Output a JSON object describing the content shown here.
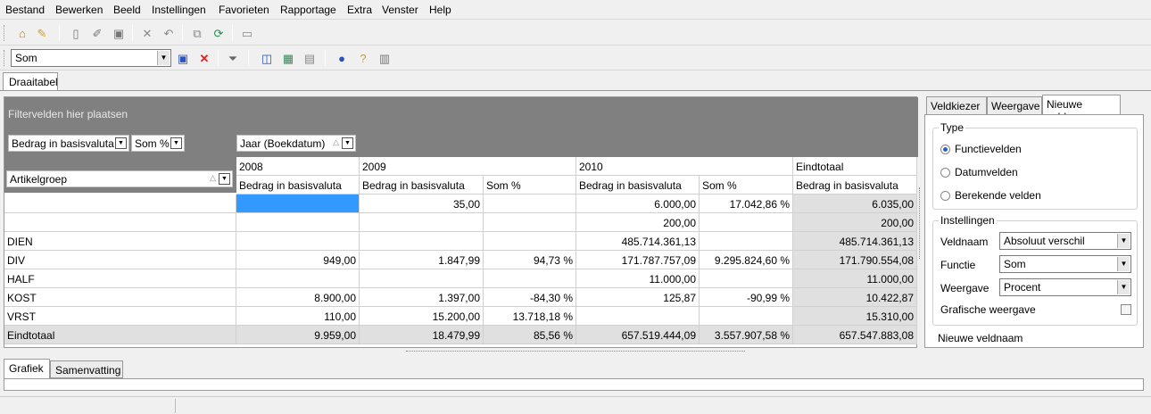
{
  "menu": [
    "Bestand",
    "Bewerken",
    "Beeld",
    "Instellingen",
    "Favorieten",
    "Rapportage",
    "Extra",
    "Venster",
    "Help"
  ],
  "toolbar2": {
    "selected": "Som"
  },
  "tab_main": "Draaitabel",
  "pivot": {
    "filter_placeholder": "Filtervelden hier plaatsen",
    "data_field1": "Bedrag in basisvaluta",
    "data_field2": "Som %",
    "col_field": "Jaar (Boekdatum)",
    "row_field": "Artikelgroep",
    "years": [
      "2008",
      "2009",
      "2010",
      "Eindtotaal"
    ],
    "measures": [
      "Bedrag in basisvaluta",
      "Bedrag in basisvaluta",
      "Som %",
      "Bedrag in basisvaluta",
      "Som %",
      "Bedrag in basisvaluta"
    ],
    "rows": [
      {
        "label": "",
        "v": [
          "",
          "35,00",
          "",
          "6.000,00",
          "17.042,86 %",
          "6.035,00"
        ]
      },
      {
        "label": "",
        "v": [
          "",
          "",
          "",
          "200,00",
          "",
          "200,00"
        ]
      },
      {
        "label": "DIEN",
        "v": [
          "",
          "",
          "",
          "485.714.361,13",
          "",
          "485.714.361,13"
        ]
      },
      {
        "label": "DIV",
        "v": [
          "949,00",
          "1.847,99",
          "94,73 %",
          "171.787.757,09",
          "9.295.824,60 %",
          "171.790.554,08"
        ]
      },
      {
        "label": "HALF",
        "v": [
          "",
          "",
          "",
          "11.000,00",
          "",
          "11.000,00"
        ]
      },
      {
        "label": "KOST",
        "v": [
          "8.900,00",
          "1.397,00",
          "-84,30 %",
          "125,87",
          "-90,99 %",
          "10.422,87"
        ]
      },
      {
        "label": "VRST",
        "v": [
          "110,00",
          "15.200,00",
          "13.718,18 %",
          "",
          "",
          "15.310,00"
        ]
      },
      {
        "label": "Eindtotaal",
        "v": [
          "9.959,00",
          "18.479,99",
          "85,56 %",
          "657.519.444,09",
          "3.557.907,58 %",
          "657.547.883,08"
        ]
      }
    ]
  },
  "right": {
    "tabs": [
      "Veldkiezer",
      "Weergave",
      "Nieuwe velden"
    ],
    "type_title": "Type",
    "type_options": [
      "Functievelden",
      "Datumvelden",
      "Berekende velden"
    ],
    "settings_title": "Instellingen",
    "veldnaam_label": "Veldnaam",
    "veldnaam_value": "Absoluut verschil",
    "functie_label": "Functie",
    "functie_value": "Som",
    "weergave_label": "Weergave",
    "weergave_value": "Procent",
    "grafisch_label": "Grafische weergave",
    "nieuwe_veldnaam": "Nieuwe veldnaam"
  },
  "bottom_tabs": [
    "Grafiek",
    "Samenvatting"
  ]
}
